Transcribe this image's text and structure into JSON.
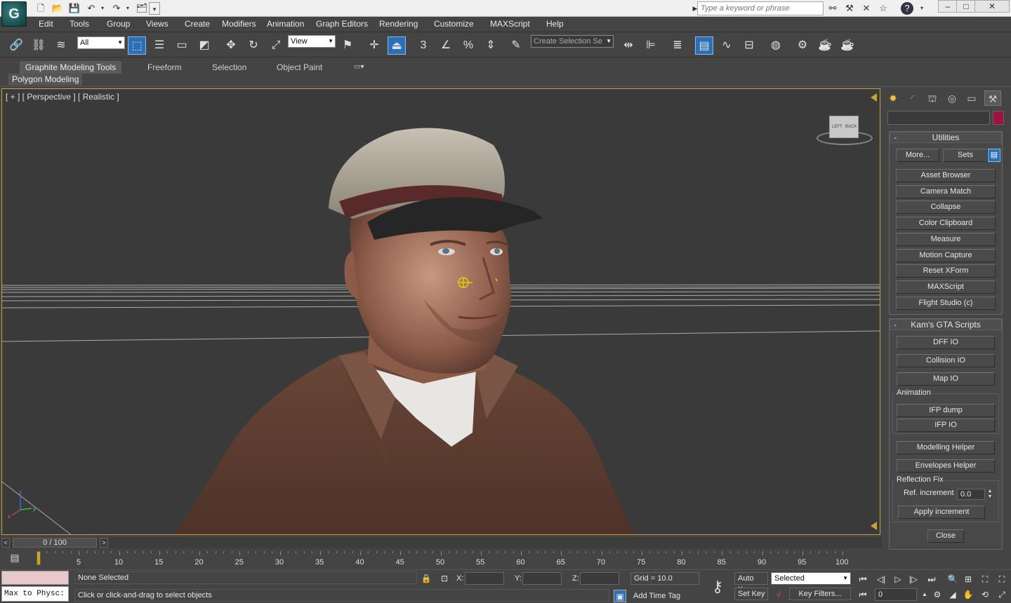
{
  "title_bar": {
    "search_placeholder": "Type a keyword or phrase",
    "window_buttons": [
      "–",
      "□",
      "✕"
    ]
  },
  "menu": [
    "Edit",
    "Tools",
    "Group",
    "Views",
    "Create",
    "Modifiers",
    "Animation",
    "Graph Editors",
    "Rendering",
    "Customize",
    "MAXScript",
    "Help"
  ],
  "toolbar": {
    "selection_filter": "All",
    "ref_coord_system": "View",
    "named_selection_placeholder": "Create Selection Se"
  },
  "ribbon": {
    "tabs": [
      "Graphite Modeling Tools",
      "Freeform",
      "Selection",
      "Object Paint"
    ],
    "active_tab": "Graphite Modeling Tools",
    "sub_label": "Polygon Modeling"
  },
  "viewport": {
    "label": "[ + ] [ Perspective ] [ Realistic ]",
    "viewcube_labels": [
      "LEFT",
      "BACK"
    ]
  },
  "command_panel": {
    "utilities": {
      "title": "Utilities",
      "more_label": "More...",
      "sets_label": "Sets",
      "buttons": [
        "Asset Browser",
        "Camera Match",
        "Collapse",
        "Color Clipboard",
        "Measure",
        "Motion Capture",
        "Reset XForm",
        "MAXScript",
        "Flight Studio (c)"
      ]
    },
    "kams": {
      "title": "Kam's GTA Scripts",
      "buttons": [
        "DFF IO",
        "Collision IO",
        "Map IO"
      ],
      "animation_label": "Animation",
      "anim_buttons": [
        "IFP dump",
        "IFP IO"
      ],
      "helper_buttons": [
        "Modelling Helper",
        "Envelopes Helper"
      ],
      "reflection_label": "Reflection Fix",
      "ref_increment_label": "Ref. increment",
      "ref_increment_value": "0.0",
      "apply_label": "Apply increment",
      "close_label": "Close"
    },
    "accent_color": "#a01040"
  },
  "timeline": {
    "frame_counter": "0 / 100",
    "ticks": [
      "5",
      "10",
      "15",
      "20",
      "25",
      "30",
      "35",
      "40",
      "45",
      "50",
      "55",
      "60",
      "65",
      "70",
      "75",
      "80",
      "85",
      "90",
      "95",
      "100"
    ]
  },
  "status": {
    "maxscript_listener": "Max to Physc:",
    "selection_status": "None Selected",
    "prompt": "Click or click-and-drag to select objects",
    "x_label": "X:",
    "y_label": "Y:",
    "z_label": "Z:",
    "grid": "Grid = 10.0",
    "add_time_tag": "Add Time Tag",
    "auto_key": "Auto Key",
    "set_key": "Set Key",
    "key_mode": "Selected",
    "key_filters": "Key Filters...",
    "current_frame": "0"
  }
}
